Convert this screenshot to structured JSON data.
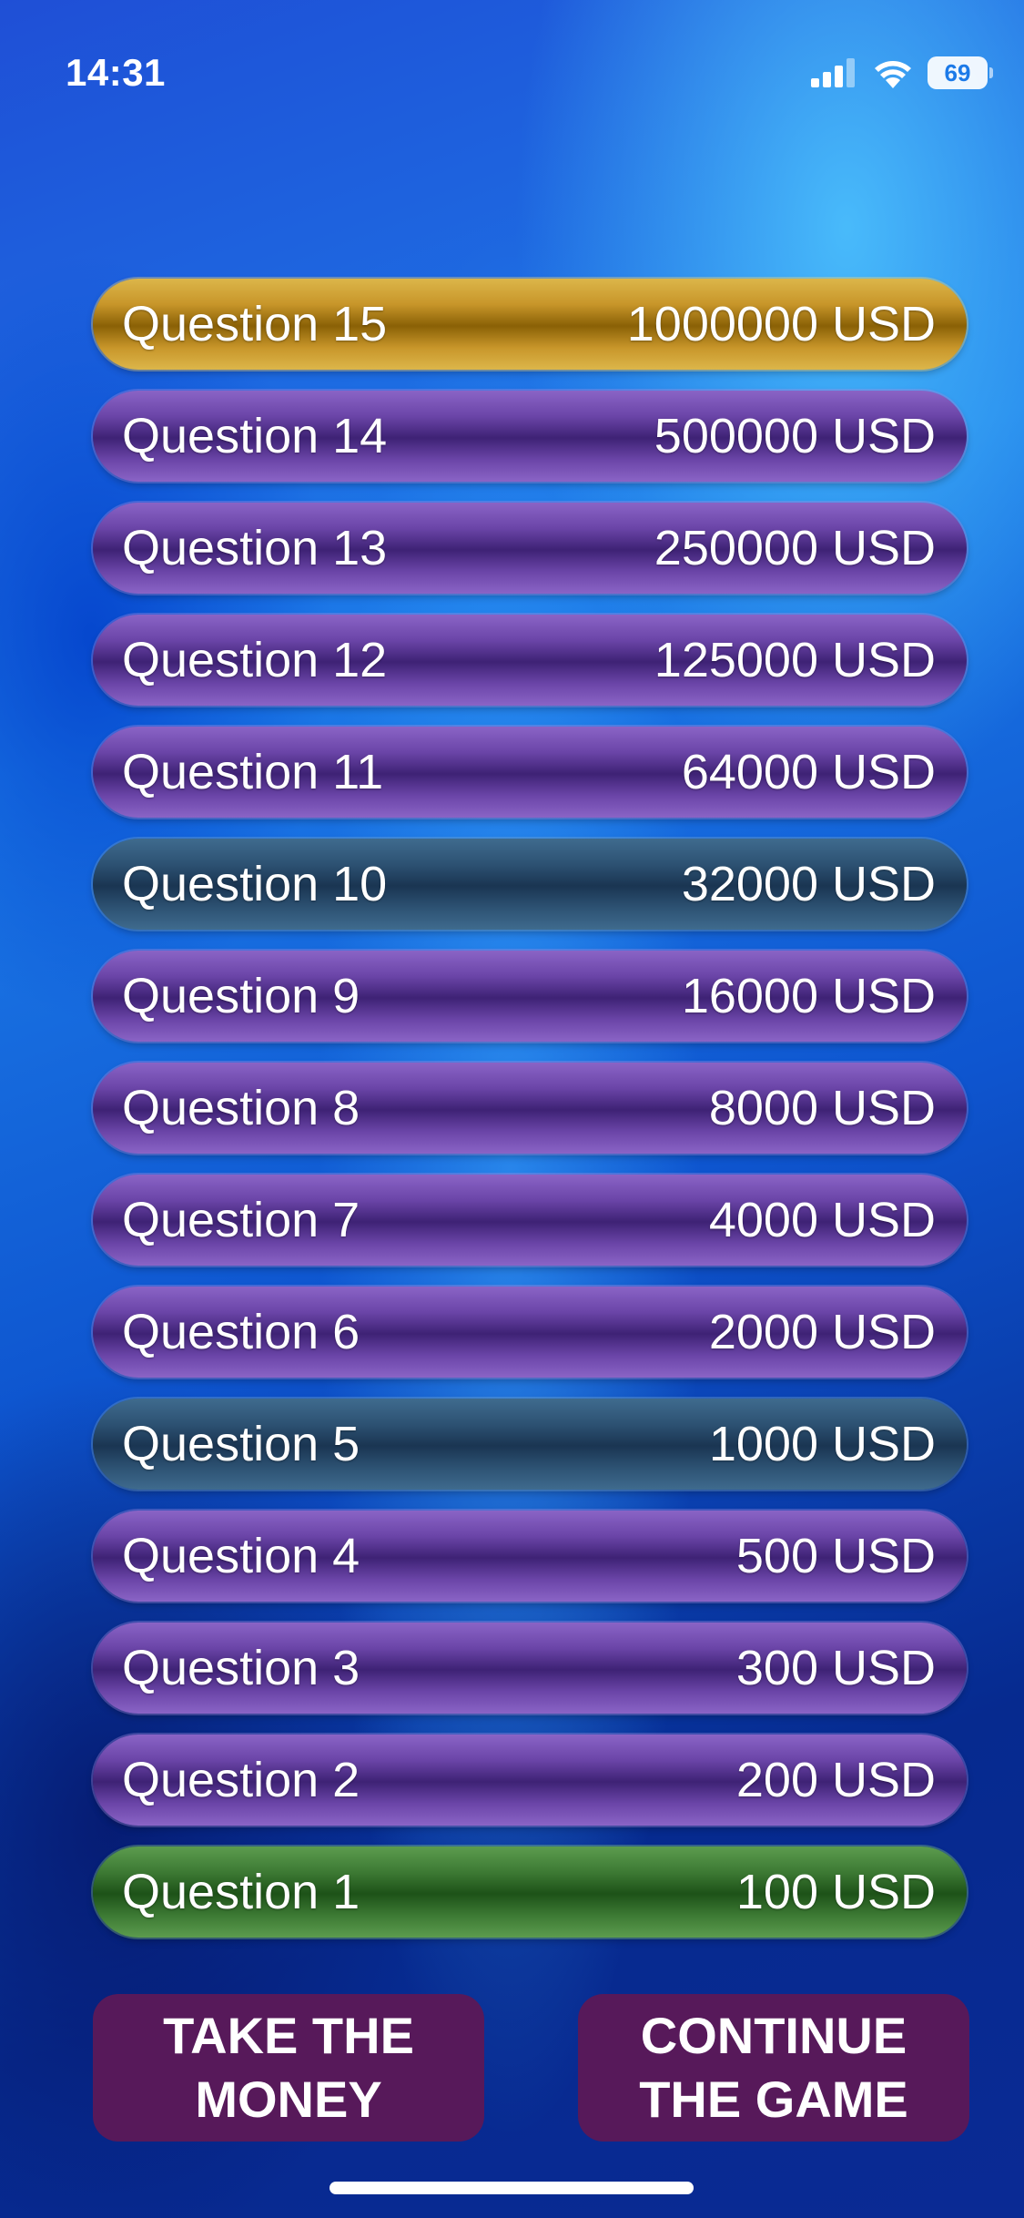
{
  "status_bar": {
    "time": "14:31",
    "battery": "69",
    "icons": [
      "signal-icon",
      "wifi-icon",
      "battery-icon"
    ]
  },
  "ladder": [
    {
      "label": "Question 15",
      "value": "1000000 USD",
      "style": "gold"
    },
    {
      "label": "Question 14",
      "value": "500000 USD",
      "style": "normal"
    },
    {
      "label": "Question 13",
      "value": "250000 USD",
      "style": "normal"
    },
    {
      "label": "Question 12",
      "value": "125000 USD",
      "style": "normal"
    },
    {
      "label": "Question 11",
      "value": "64000 USD",
      "style": "normal"
    },
    {
      "label": "Question 10",
      "value": "32000 USD",
      "style": "milestone"
    },
    {
      "label": "Question 9",
      "value": "16000 USD",
      "style": "normal"
    },
    {
      "label": "Question 8",
      "value": "8000 USD",
      "style": "normal"
    },
    {
      "label": "Question 7",
      "value": "4000 USD",
      "style": "normal"
    },
    {
      "label": "Question 6",
      "value": "2000 USD",
      "style": "normal"
    },
    {
      "label": "Question 5",
      "value": "1000 USD",
      "style": "milestone"
    },
    {
      "label": "Question 4",
      "value": "500 USD",
      "style": "normal"
    },
    {
      "label": "Question 3",
      "value": "300 USD",
      "style": "normal"
    },
    {
      "label": "Question 2",
      "value": "200 USD",
      "style": "normal"
    },
    {
      "label": "Question 1",
      "value": "100 USD",
      "style": "current"
    }
  ],
  "buttons": {
    "take_money": [
      "TAKE THE",
      "MONEY"
    ],
    "continue_game": [
      "CONTINUE",
      "THE GAME"
    ]
  },
  "colors": {
    "gold": "#c8962a",
    "normal": "#6b45a8",
    "milestone": "#2d5273",
    "current": "#3d7a34",
    "button": "#57195a"
  }
}
